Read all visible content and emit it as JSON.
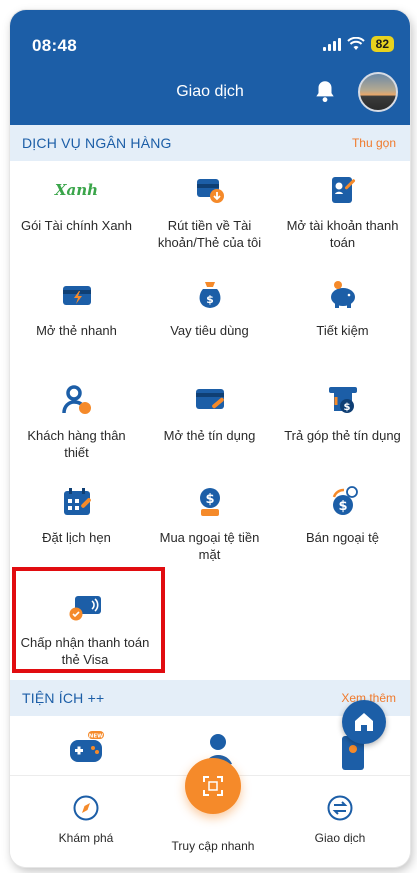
{
  "status_bar": {
    "time": "08:48",
    "battery": "82"
  },
  "header": {
    "title": "Giao dịch"
  },
  "banking_section": {
    "title": "DỊCH VỤ NGÂN HÀNG",
    "collapse_label": "Thu gọn",
    "items": [
      {
        "label": "Gói Tài chính Xanh",
        "icon": "xanh-logo",
        "logo_text": "Xanh"
      },
      {
        "label": "Rút tiền về Tài khoản/Thẻ của tôi",
        "icon": "withdraw-card-icon"
      },
      {
        "label": "Mở tài khoản thanh toán",
        "icon": "open-account-icon"
      },
      {
        "label": "Mở thẻ nhanh",
        "icon": "quick-card-icon"
      },
      {
        "label": "Vay tiêu dùng",
        "icon": "money-bag-icon"
      },
      {
        "label": "Tiết kiệm",
        "icon": "piggy-bank-icon"
      },
      {
        "label": "Khách hàng thân thiết",
        "icon": "loyal-customer-icon"
      },
      {
        "label": "Mở thẻ tín dụng",
        "icon": "credit-card-icon"
      },
      {
        "label": "Trả góp thẻ tín dụng",
        "icon": "installment-icon"
      },
      {
        "label": "Đặt lịch hẹn",
        "icon": "calendar-icon"
      },
      {
        "label": "Mua ngoại tệ tiền mặt",
        "icon": "buy-currency-icon"
      },
      {
        "label": "Bán ngoại tệ",
        "icon": "sell-currency-icon"
      },
      {
        "label": "Chấp nhận thanh toán thẻ Visa",
        "icon": "contactless-card-icon"
      }
    ]
  },
  "utilities_section": {
    "title": "TIỆN ÍCH ++",
    "more_label": "Xem thêm",
    "new_badge": "NEW"
  },
  "bottom_nav": {
    "items": [
      {
        "label": "Khám phá",
        "icon": "compass-icon"
      },
      {
        "label": "Truy cập nhanh",
        "icon": "scan-icon"
      },
      {
        "label": "Giao dịch",
        "icon": "transfer-icon"
      }
    ]
  },
  "colors": {
    "brand_blue": "#1c5ea7",
    "accent_orange": "#f58a2a",
    "highlight_red": "#e10c10",
    "section_bg": "#e4eef8"
  }
}
